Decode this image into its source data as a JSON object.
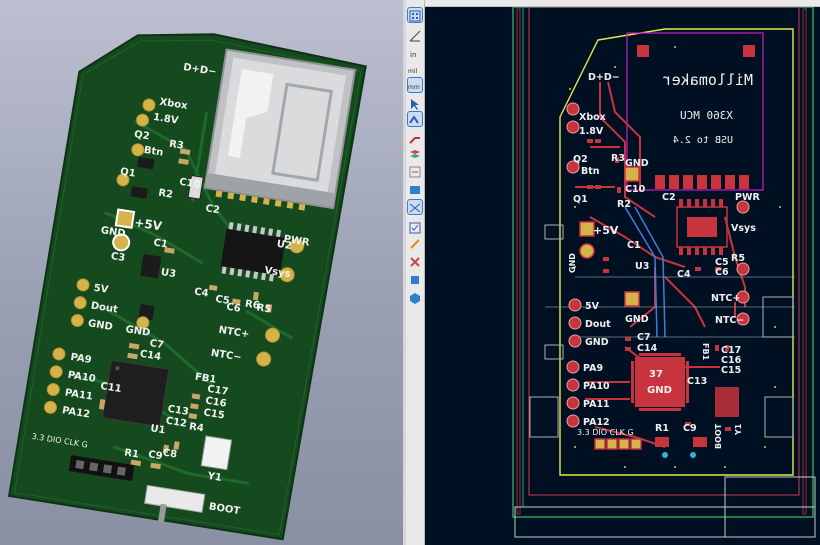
{
  "view3d": {
    "silkscreen": {
      "dp_dm": "D+D−",
      "xbox": "Xbox",
      "v18": "1.8V",
      "q2": "Q2",
      "r3": "R3",
      "btn": "Btn",
      "q1": "Q1",
      "r2": "R2",
      "c10": "C10",
      "c2": "C2",
      "u2": "U2",
      "pwr": "PWR",
      "plus5v": "+5V",
      "gnd_top": "GND",
      "c1": "C1",
      "c3": "C3",
      "u3": "U3",
      "vsys": "Vsys",
      "c4": "C4",
      "c5": "C5",
      "c6": "C6",
      "r5": "R5",
      "r6": "R6",
      "ntc_plus": "NTC+",
      "ntc_minus": "NTC−",
      "v5": "5V",
      "dout": "Dout",
      "gnd_mid": "GND",
      "gnd_left": "GND",
      "c7": "C7",
      "c14": "C14",
      "fb1": "FB1",
      "pa9": "PA9",
      "pa10": "PA10",
      "pa11": "PA11",
      "pa12": "PA12",
      "c11": "C11",
      "c17": "C17",
      "c16": "C16",
      "c15": "C15",
      "c13": "C13",
      "c12": "C12",
      "u1": "U1",
      "r4": "R4",
      "y1": "Y1",
      "r1": "R1",
      "c8": "C8",
      "c9": "C9",
      "boot": "BOOT",
      "swd": "3.3 DIO CLK G"
    }
  },
  "pcb": {
    "logo": "Millomaker",
    "title1": "X360 MCU",
    "title2": "USB to 2.4",
    "chip_pins": "37",
    "chip_gnd": "GND",
    "labels": {
      "dp_dm": "D+D−",
      "xbox": "Xbox",
      "v18": "1.8V",
      "q2": "Q2",
      "r3": "R3",
      "btn": "Btn",
      "q1": "Q1",
      "r2": "R2",
      "c10": "C10",
      "gnd_top": "GND",
      "c2": "C2",
      "pwr": "PWR",
      "vsys": "Vsys",
      "plus5v": "+5V",
      "c1": "C1",
      "u3": "U3",
      "c4": "C4",
      "c5": "C5",
      "c6": "C6",
      "r5": "R5",
      "ntc_plus": "NTC+",
      "ntc_minus": "NTC−",
      "gnd_left": "GND",
      "gnd_mid": "GND",
      "v5": "5V",
      "dout": "Dout",
      "gnd_low": "GND",
      "c7": "C7",
      "c14": "C14",
      "fb1": "FB1",
      "c17": "C17",
      "c16": "C16",
      "c15": "C15",
      "c13": "C13",
      "pa9": "PA9",
      "pa10": "PA10",
      "pa11": "PA11",
      "pa12": "PA12",
      "swd": "3.3 DIO CLK G",
      "r1": "R1",
      "c9": "C9",
      "boot": "BOOT",
      "y1": "Y1"
    }
  },
  "toolbar": {
    "tools": [
      "select-tool",
      "grid-tool",
      "units-in-tool",
      "units-mil-tool",
      "units-mm-tool",
      "cursor-tool",
      "highlight-tool",
      "route-tool",
      "layers-tool",
      "net-tool",
      "zone-tool",
      "ratsnest-tool",
      "drc-tool",
      "via-tool",
      "flip-tool",
      "3d-tool",
      "polar-tool"
    ]
  },
  "colors": {
    "board3d": "#15491e",
    "silk": "#f1f1f1",
    "pad_gold": "#d6b24a",
    "pcb_bg": "#001023",
    "fcu": "#c8343d",
    "silk_pcb": "#f0f0f0",
    "outline": "#e8e84c",
    "courtyard": "#c81ec8",
    "keepout": "#2f9e55"
  }
}
